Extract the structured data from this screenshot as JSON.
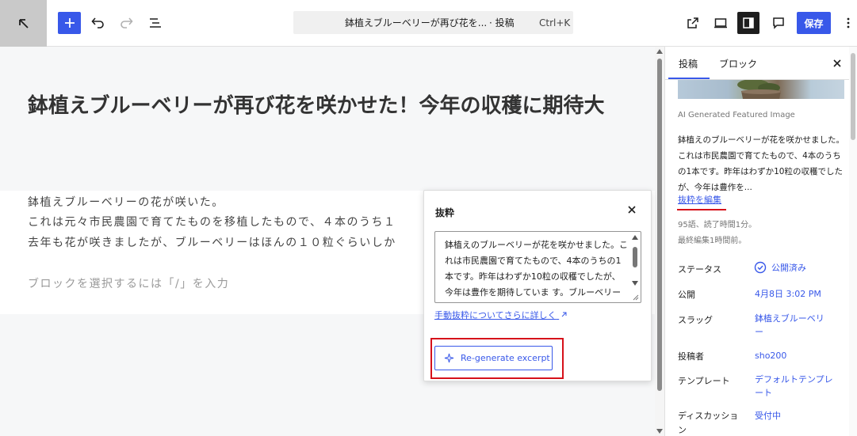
{
  "toolbar": {
    "back_icon": "arrow-up-left-icon",
    "add_icon": "plus-icon",
    "undo_icon": "undo-icon",
    "redo_icon": "redo-icon",
    "list_view_icon": "list-view-icon",
    "command_bar": {
      "title": "鉢植えブルーベリーが再び花を...",
      "post_type": "· 投稿",
      "shortcut": "Ctrl+K"
    },
    "view_icon": "external-link-icon",
    "preview_icon": "desktop-preview-icon",
    "settings_icon": "sidebar-toggle-icon",
    "comments_icon": "comment-icon",
    "save_label": "保存",
    "more_icon": "vertical-ellipsis-icon",
    "colors": {
      "accent": "#3858e9",
      "dark": "#1e1e1e"
    }
  },
  "editor": {
    "post_title": "鉢植えブルーベリーが再び花を咲かせた！今年の収穫に期待大",
    "paragraphs": [
      "鉢植えブルーベリーの花が咲いた。",
      "これは元々市民農園で育てたものを移植したもので、４本のうち１",
      "去年も花が咲きましたが、ブルーベリーはほんの１０粒ぐらいしか"
    ],
    "block_placeholder": "ブロックを選択するには「/」を入力"
  },
  "excerpt_popover": {
    "title": "抜粋",
    "close_icon": "close-icon",
    "excerpt_text": "鉢植えのブルーベリーが花を咲かせました。これは市民農園で育てたもので、4本のうちの1本です。昨年はわずか10粒の収穫でしたが、今年は豊作を期待していま す。ブルーベリーの成長と収穫への期待が",
    "learn_more_link": "手動抜粋についてさらに詳しく",
    "learn_more_icon": "external-arrow-icon",
    "regenerate_label": "Re-generate excerpt",
    "regenerate_icon": "ai-sparkle-icon",
    "highlight_color": "#d6111a"
  },
  "sidebar": {
    "tabs": [
      "投稿",
      "ブロック"
    ],
    "active_tab": "投稿",
    "close_icon": "close-icon",
    "featured_image_caption": "AI Generated Featured Image",
    "excerpt_preview": "鉢植えのブルーベリーが花を咲かせました。これは市民農園で育てたもので、4本のうちの1本です。昨年はわずか10粒の収穫でしたが、今年は豊作を...",
    "edit_excerpt_link": "抜粋を編集",
    "meta_words": "95語、読了時間1分。",
    "meta_edited": "最終編集1時間前。",
    "rows": [
      {
        "label": "ステータス",
        "value": "公開済み"
      },
      {
        "label": "公開",
        "value": "4月8日 3:02 PM"
      },
      {
        "label": "スラッグ",
        "value": "鉢植えブルーベリー"
      },
      {
        "label": "投稿者",
        "value": "sho200"
      },
      {
        "label": "テンプレート",
        "value": "デフォルトテンプレート"
      },
      {
        "label": "ディスカッション",
        "value": "受付中"
      }
    ],
    "status_icon": "check-circle-icon"
  }
}
